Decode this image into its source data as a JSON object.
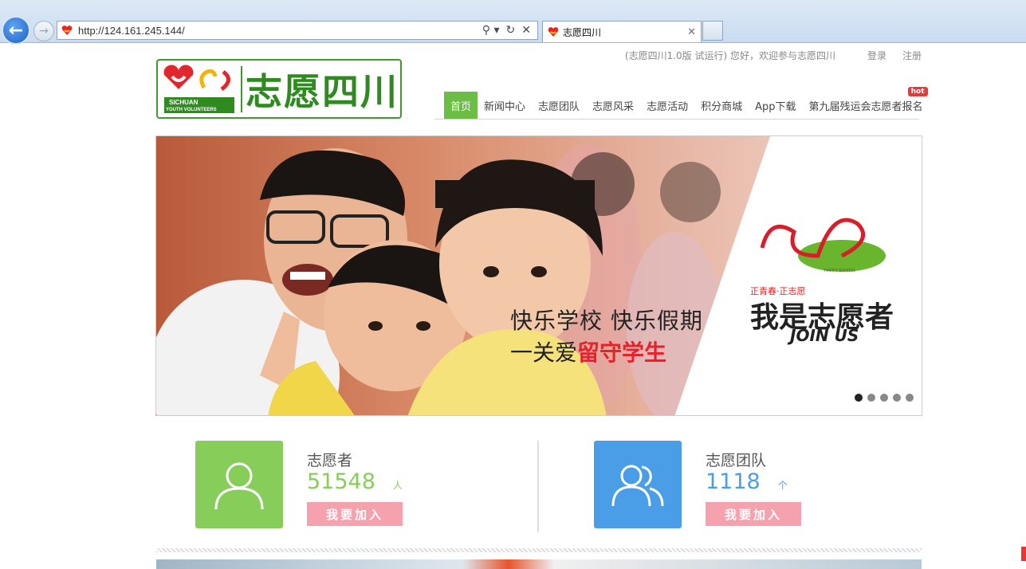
{
  "browser": {
    "url": "http://124.161.245.144/",
    "tab_title": "志愿四川",
    "close_glyph": "✕",
    "search_ctl": "⚲ ▾",
    "refresh_ctl": "↻",
    "stop_ctl": "✕",
    "back_glyph": "←",
    "forward_glyph": "→"
  },
  "header": {
    "welcome": "(志愿四川1.0版 试运行) 您好，欢迎参与志愿四川",
    "login": "登录",
    "register": "注册",
    "logo_text": "志愿四川",
    "logo_en_line1": "SICHUAN",
    "logo_en_line2": "YOUTH VOLUNTEERS"
  },
  "nav": {
    "items": [
      {
        "label": "首页",
        "active": true
      },
      {
        "label": "新闻中心"
      },
      {
        "label": "志愿团队"
      },
      {
        "label": "志愿风采"
      },
      {
        "label": "志愿活动"
      },
      {
        "label": "积分商城"
      },
      {
        "label": "App下载"
      },
      {
        "label": "第九届残运会志愿者报名",
        "badge": "hot"
      }
    ]
  },
  "banner": {
    "line1": "快乐学校  快乐假期",
    "line2_prefix": "一关爱",
    "line2_highlight": "留守学生",
    "logo_caption": "HAPPY SCHOOL",
    "slogan_small": "正青春·正志愿",
    "slogan_big": "我是志愿者",
    "join": "JOIN US",
    "slides": 5,
    "active_slide": 1
  },
  "stats": {
    "volunteers": {
      "label": "志愿者",
      "value": "51548",
      "unit": "人",
      "button": "我要加入",
      "color": "#86cd5a"
    },
    "teams": {
      "label": "志愿团队",
      "value": "1118",
      "unit": "个",
      "button": "我要加入",
      "color": "#4a9ee8"
    }
  }
}
